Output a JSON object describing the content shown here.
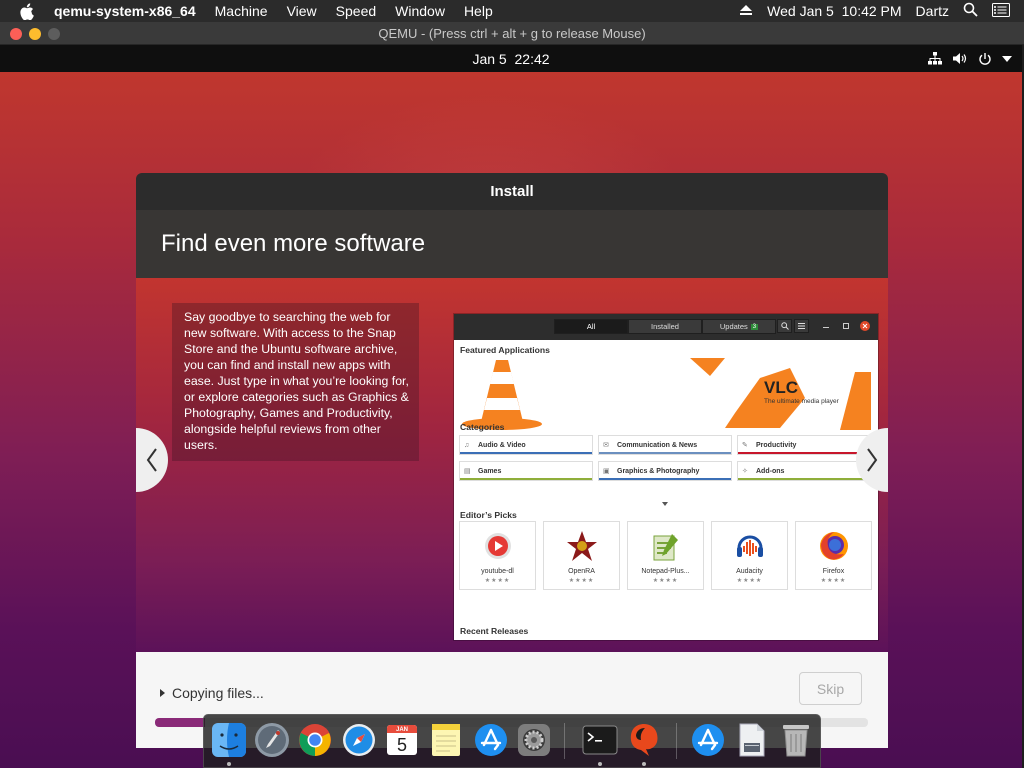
{
  "mac_menubar": {
    "app_name": "qemu-system-x86_64",
    "menus": [
      "Machine",
      "View",
      "Speed",
      "Window",
      "Help"
    ],
    "clock": "Wed Jan 5  10:42 PM",
    "user": "Dartz"
  },
  "qemu_window": {
    "title": "QEMU - (Press ctrl + alt + g to release Mouse)"
  },
  "ubuntu_topbar": {
    "clock": "Jan 5  22:42"
  },
  "installer": {
    "window_title": "Install",
    "heading": "Find even more software",
    "slide_text": "Say goodbye to searching the web for new software. With access to the Snap Store and the Ubuntu software archive, you can find and install new apps with ease. Just type in what you’re looking for, or explore categories such as Graphics & Photography, Games and Productivity, alongside helpful reviews from other users.",
    "progress_label": "Copying files...",
    "progress_fraction": 0.07,
    "skip_label": "Skip",
    "accent_color": "#8a2a78"
  },
  "software_screenshot": {
    "tabs": [
      "All",
      "Installed",
      "Updates"
    ],
    "updates_count": "3",
    "featured_heading": "Featured Applications",
    "featured_app": "VLC",
    "featured_tagline": "The ultimate media player",
    "categories_heading": "Categories",
    "categories": [
      {
        "label": "Audio & Video",
        "color": "#3b6fb6"
      },
      {
        "label": "Communication & News",
        "color": "#6b8fbf"
      },
      {
        "label": "Productivity",
        "color": "#c7162b"
      },
      {
        "label": "Games",
        "color": "#8fae3a"
      },
      {
        "label": "Graphics & Photography",
        "color": "#3b6fb6"
      },
      {
        "label": "Add-ons",
        "color": "#8fae3a"
      }
    ],
    "editors_heading": "Editor’s Picks",
    "picks": [
      {
        "name": "youtube-dl",
        "rating": "★★★★"
      },
      {
        "name": "OpenRA",
        "rating": "★★★★"
      },
      {
        "name": "Notepad-Plus...",
        "rating": "★★★★"
      },
      {
        "name": "Audacity",
        "rating": "★★★★"
      },
      {
        "name": "Firefox",
        "rating": "★★★★"
      }
    ],
    "recent_heading": "Recent Releases"
  },
  "dock": {
    "items": [
      "finder-icon",
      "launchpad-icon",
      "chrome-icon",
      "safari-icon",
      "calendar-icon",
      "notes-icon",
      "app-store-icon",
      "system-preferences-icon",
      "terminal-icon",
      "qemu-icon",
      "app-store-downloads-icon",
      "preview-icon",
      "trash-icon"
    ],
    "calendar_month": "JAN",
    "calendar_day": "5"
  }
}
